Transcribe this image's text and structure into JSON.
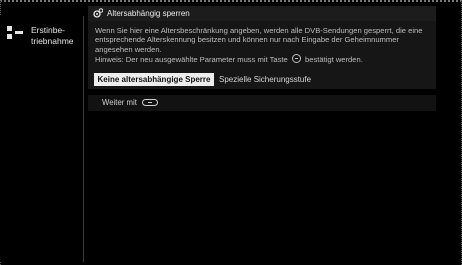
{
  "sidebar": {
    "label": "Erstinbe-triebnahme",
    "icon": "setup-grid-icon"
  },
  "panel": {
    "title": "Altersabhängig sperren",
    "title_icon": "parental-lock-icon",
    "description": "Wenn Sie hier eine Altersbeschränkung angeben, werden alle DVB-Sendungen gesperrt, die eine entsprechende Alterskennung besitzen und können nur nach Eingabe der Geheimnummer angesehen werden.",
    "hint_prefix": "Hinweis: Der neu ausgewählte Parameter muss mit Taste",
    "hint_key_icon": "ok-key-icon",
    "hint_suffix": "bestätigt werden.",
    "options": [
      {
        "label": "Keine altersabhängige Sperre",
        "selected": true
      },
      {
        "label": "Spezielle Sicherungsstufe",
        "selected": false
      }
    ]
  },
  "continue_row": {
    "label": "Weiter mit",
    "key_icon": "forward-key-icon"
  },
  "colors": {
    "background": "#000000",
    "panel": "#161616",
    "selected_option": "#ededed",
    "text": "#cfcfcf"
  }
}
